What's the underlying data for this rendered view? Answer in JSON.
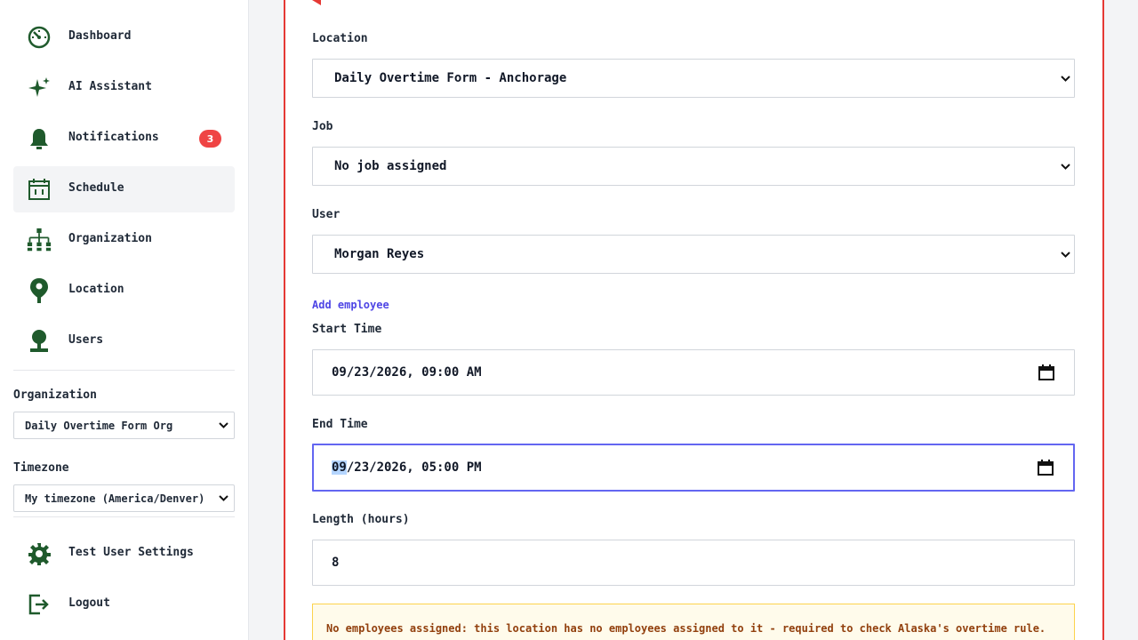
{
  "sidebar": {
    "nav": [
      {
        "label": "Dashboard",
        "icon": "dashboard-icon"
      },
      {
        "label": "AI Assistant",
        "icon": "sparkle-icon"
      },
      {
        "label": "Notifications",
        "icon": "bell-icon",
        "badge": "3"
      },
      {
        "label": "Schedule",
        "icon": "calendar-icon",
        "active": true
      },
      {
        "label": "Organization",
        "icon": "org-chart-icon"
      },
      {
        "label": "Location",
        "icon": "map-pin-icon"
      },
      {
        "label": "Users",
        "icon": "user-icon"
      }
    ],
    "organization": {
      "label": "Organization",
      "value": "Daily Overtime Form Org"
    },
    "timezone": {
      "label": "Timezone",
      "value": "My timezone (America/Denver)"
    },
    "footer": [
      {
        "label": "Test User Settings",
        "icon": "gear-icon"
      },
      {
        "label": "Logout",
        "icon": "logout-icon"
      }
    ]
  },
  "form": {
    "location": {
      "label": "Location",
      "value": "Daily Overtime Form - Anchorage"
    },
    "job": {
      "label": "Job",
      "value": "No job assigned"
    },
    "user": {
      "label": "User",
      "value": "Morgan Reyes"
    },
    "add_employee": "Add employee",
    "start_time": {
      "label": "Start Time",
      "value": "09/23/2026, 09:00 AM"
    },
    "end_time": {
      "label": "End Time",
      "month": "09",
      "rest": "/23/2026, 05:00 PM"
    },
    "length": {
      "label": "Length (hours)",
      "value": "8"
    },
    "warning": "No employees assigned: this location has no employees assigned to it - required to check Alaska's overtime rule."
  },
  "colors": {
    "icon_green": "#1f5a2c",
    "badge_red": "#ef4444",
    "panel_border": "#e53935",
    "focus": "#6366f1",
    "link": "#4f46e5"
  }
}
